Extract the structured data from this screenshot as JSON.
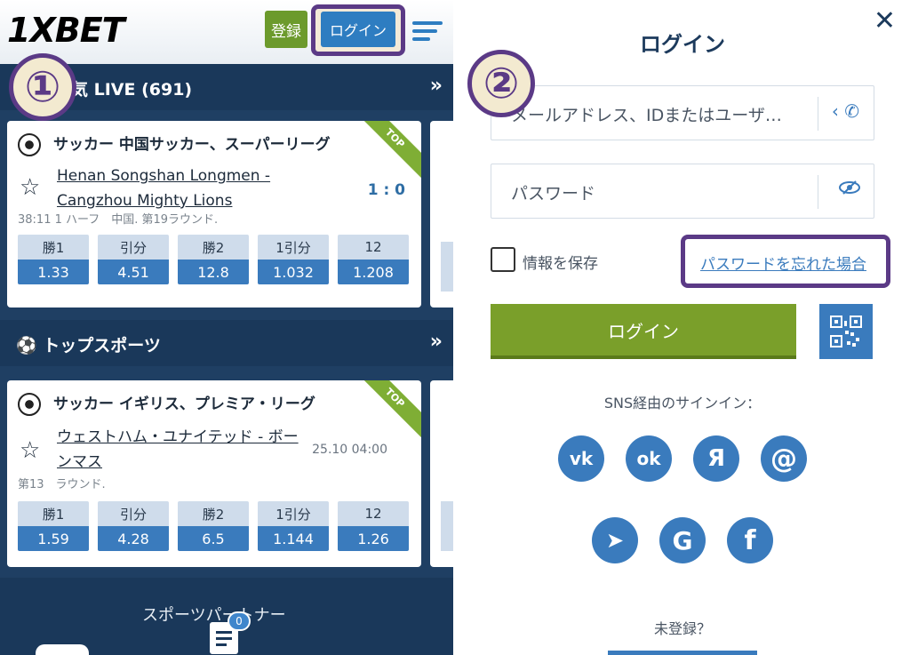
{
  "header": {
    "logo": "1XBET",
    "register_label": "登録",
    "login_label": "ログイン"
  },
  "steps": [
    "①",
    "②"
  ],
  "live_section": {
    "title": "気 LIVE (691)",
    "arrow": "»"
  },
  "top_section": {
    "title": "トップスポーツ",
    "arrow": "»"
  },
  "matches": [
    {
      "league": "サッカー 中国サッカー、スーパーリーグ",
      "ribbon": "TOP",
      "teams": "Henan Songshan Longmen - Cangzhou Mighty Lions",
      "score": "1 : 0",
      "meta": "38:11 1 ハーフ　中国. 第19ラウンド.",
      "odds": [
        {
          "label": "勝1",
          "value": "1.33"
        },
        {
          "label": "引分",
          "value": "4.51"
        },
        {
          "label": "勝2",
          "value": "12.8"
        },
        {
          "label": "1引分",
          "value": "1.032"
        },
        {
          "label": "12",
          "value": "1.208"
        }
      ]
    },
    {
      "league": "サッカー イギリス、プレミア・リーグ",
      "ribbon": "TOP",
      "teams": "ウェストハム・ユナイテッド - ボーンマス",
      "time": "25.10 04:00",
      "meta": "第13　ラウンド.",
      "odds": [
        {
          "label": "勝1",
          "value": "1.59"
        },
        {
          "label": "引分",
          "value": "4.28"
        },
        {
          "label": "勝2",
          "value": "6.5"
        },
        {
          "label": "1引分",
          "value": "1.144"
        },
        {
          "label": "12",
          "value": "1.26"
        }
      ]
    }
  ],
  "partner": {
    "title": "スポーツパートナー",
    "badge_count": "0"
  },
  "login_modal": {
    "title": "ログイン",
    "close": "✕",
    "id_placeholder": "メールアドレス、IDまたはユーザ…",
    "password_placeholder": "パスワード",
    "remember_label": "情報を保存",
    "forgot_link": "パスワードを忘れた場合",
    "submit_label": "ログイン",
    "sns_label": "SNS経由のサインイン：",
    "sns": [
      {
        "name": "vk",
        "glyph": "vk"
      },
      {
        "name": "odnoklassniki",
        "glyph": "ok"
      },
      {
        "name": "yandex",
        "glyph": "Я"
      },
      {
        "name": "mail",
        "glyph": "@"
      },
      {
        "name": "telegram",
        "glyph": "➤"
      },
      {
        "name": "google",
        "glyph": "G"
      },
      {
        "name": "facebook",
        "glyph": "f"
      }
    ],
    "unregistered": "未登録？"
  },
  "colors": {
    "brand_blue": "#1a5fa6",
    "accent_blue": "#3a7bbd",
    "green": "#7a9f2a",
    "panel_navy": "#1f3f63",
    "highlight_purple": "#5b3a86"
  }
}
